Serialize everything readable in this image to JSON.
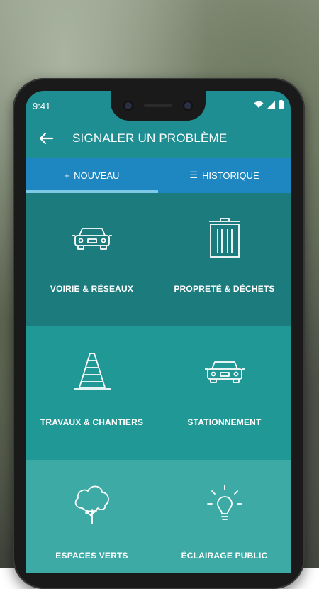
{
  "status_bar": {
    "time": "9:41"
  },
  "header": {
    "title": "SIGNALER UN PROBLÈME",
    "back_icon": "arrow-left-icon"
  },
  "tabs": [
    {
      "label": "NOUVEAU",
      "icon": "+",
      "active": true
    },
    {
      "label": "HISTORIQUE",
      "icon": "☰",
      "active": false
    }
  ],
  "categories": [
    {
      "label": "VOIRIE & RÉSEAUX",
      "icon": "car-icon"
    },
    {
      "label": "PROPRETÉ & DÉCHETS",
      "icon": "trash-icon"
    },
    {
      "label": "TRAVAUX & CHANTIERS",
      "icon": "traffic-cone-icon"
    },
    {
      "label": "STATIONNEMENT",
      "icon": "car-icon"
    },
    {
      "label": "ESPACES VERTS",
      "icon": "tree-icon"
    },
    {
      "label": "ÉCLAIRAGE PUBLIC",
      "icon": "lightbulb-icon"
    }
  ],
  "colors": {
    "teal_dark": "#1b7b7d",
    "teal": "#209896",
    "teal_light": "#3daaa6",
    "tab_blue": "#1e86c0",
    "tab_indicator": "#7ec8e8"
  }
}
